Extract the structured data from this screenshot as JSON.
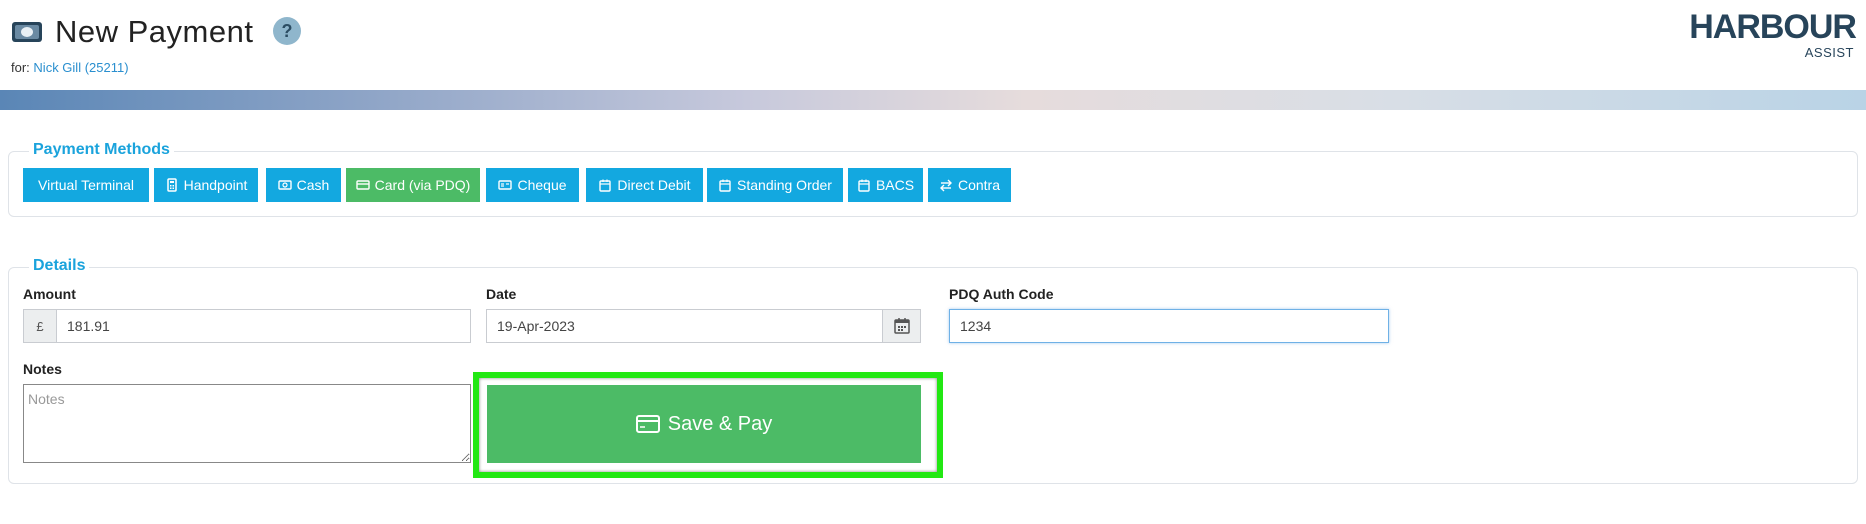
{
  "header": {
    "title": "New Payment",
    "help": "?",
    "for_label": "for:",
    "customer": "Nick Gill (25211)",
    "logo_main": "HARBOUR",
    "logo_sub": "ASSIST",
    "title_icon": "money-icon"
  },
  "payment_methods": {
    "legend": "Payment Methods",
    "items": [
      {
        "label": "Virtual Terminal",
        "icon": "",
        "active": false
      },
      {
        "label": "Handpoint",
        "icon": "calculator-icon",
        "active": false
      },
      {
        "label": "Cash",
        "icon": "money-icon",
        "active": false
      },
      {
        "label": "Card (via PDQ)",
        "icon": "credit-card-icon",
        "active": true
      },
      {
        "label": "Cheque",
        "icon": "cheque-icon",
        "active": false
      },
      {
        "label": "Direct Debit",
        "icon": "calendar-icon",
        "active": false
      },
      {
        "label": "Standing Order",
        "icon": "calendar-icon",
        "active": false
      },
      {
        "label": "BACS",
        "icon": "calendar-icon",
        "active": false
      },
      {
        "label": "Contra",
        "icon": "exchange-icon",
        "active": false
      }
    ]
  },
  "details": {
    "legend": "Details",
    "amount_label": "Amount",
    "currency": "£",
    "amount_value": "181.91",
    "date_label": "Date",
    "date_value": "19-Apr-2023",
    "auth_label": "PDQ Auth Code",
    "auth_value": "1234",
    "notes_label": "Notes",
    "notes_placeholder": "Notes",
    "save_label": "Save & Pay"
  },
  "colors": {
    "primary": "#13a8e0",
    "success": "#4cbb66",
    "highlight": "#22e813",
    "brand": "#27445a"
  }
}
